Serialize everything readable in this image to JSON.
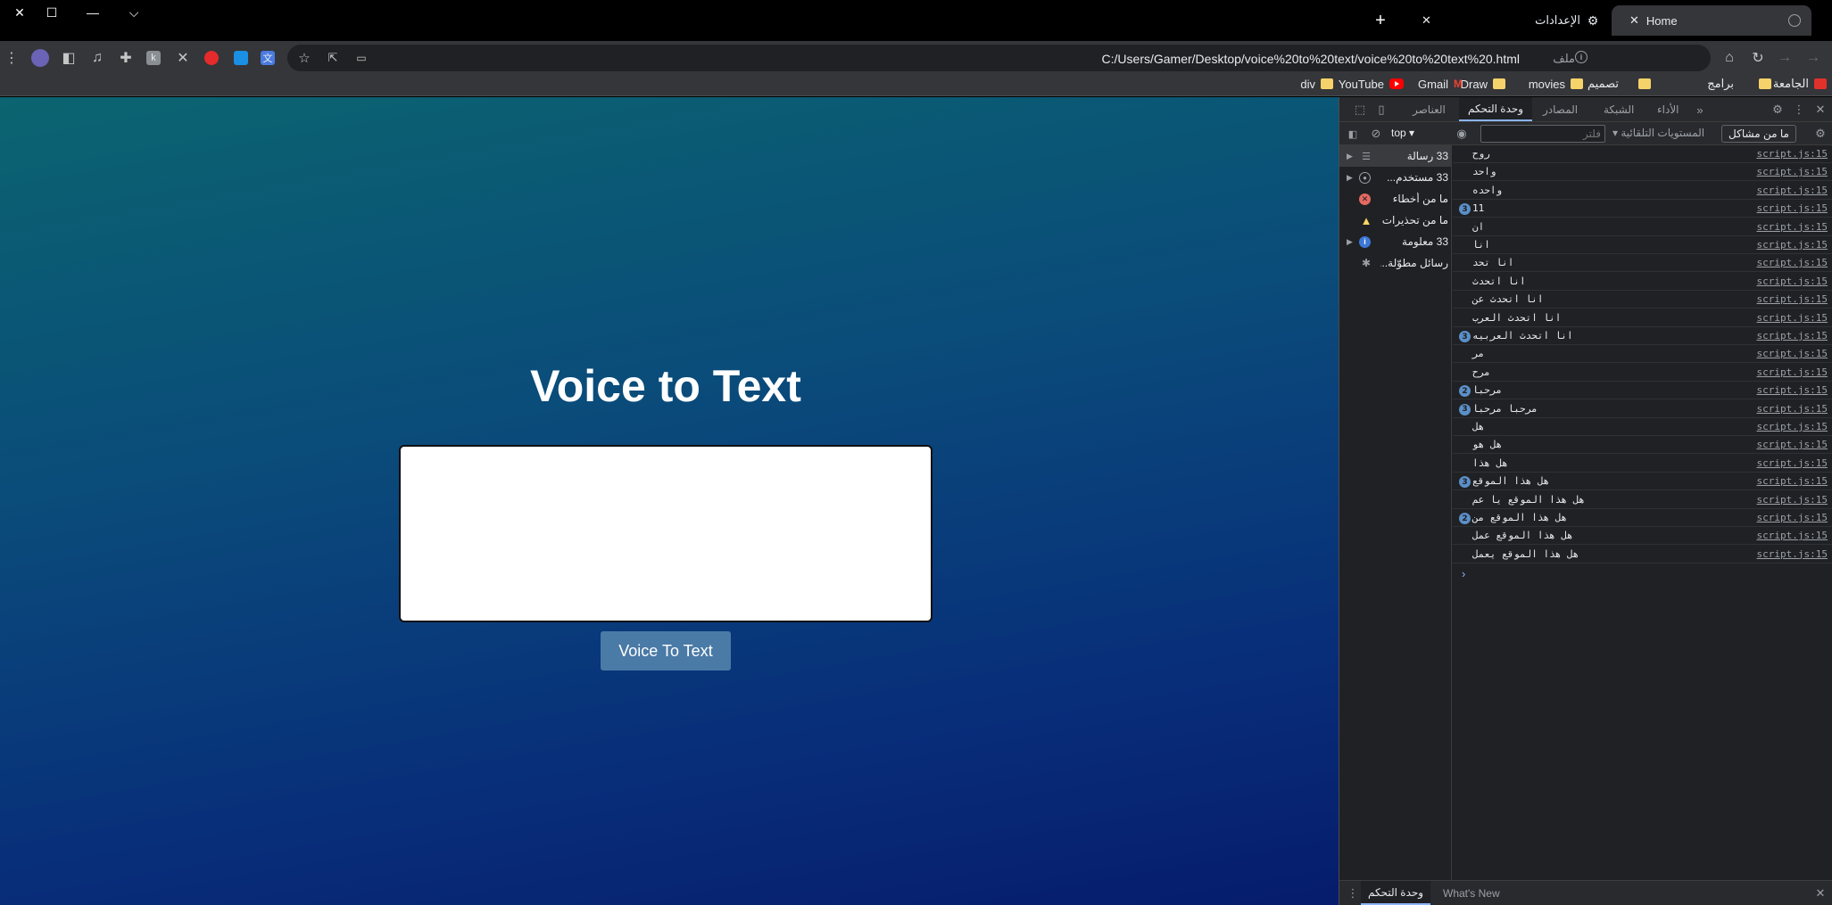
{
  "window": {
    "close_glyph": "✕",
    "maximize_glyph": "☐",
    "minimize_glyph": "—",
    "tab_search_glyph": "⌵"
  },
  "tabs": [
    {
      "title": "Home",
      "active": true
    },
    {
      "title": "الإعدادات",
      "active": false
    }
  ],
  "new_tab_glyph": "+",
  "close_tab_glyph": "✕",
  "address_bar": {
    "url": "C:/Users/Gamer/Desktop/voice%20to%20text/voice%20to%20text%20.html",
    "scheme_label": "ملف"
  },
  "bookmarks": [
    {
      "label": "الجامعة",
      "icon": "folder"
    },
    {
      "label": "برامج",
      "icon": "folder"
    },
    {
      "label": "تصميم",
      "icon": "folder"
    },
    {
      "label": "movies",
      "icon": "folder"
    },
    {
      "label": "Draw",
      "icon": "folder"
    },
    {
      "label": "Gmail",
      "icon": "gmail"
    },
    {
      "label": "YouTube",
      "icon": "youtube"
    },
    {
      "label": "div",
      "icon": "folder"
    }
  ],
  "page": {
    "title": "Voice to Text",
    "textarea_value": "",
    "button_label": "Voice To Text"
  },
  "devtools": {
    "tabs": [
      "العناصر",
      "وحدة التحكم",
      "المصادر",
      "الشبكة",
      "الأداء"
    ],
    "active_tab": "وحدة التحكم",
    "more_tabs_glyph": "»",
    "context": "top",
    "filter_placeholder": "فلتر",
    "levels_label": "المستويات التلقائية",
    "issues_label": "ما من مشاكل",
    "sidebar": [
      {
        "label": "33 رسالة",
        "icon": "list-icon",
        "expandable": true,
        "selected": true
      },
      {
        "label": "33 مستخدم...",
        "icon": "user-icon",
        "expandable": true,
        "selected": false
      },
      {
        "label": "ما من أخطاء",
        "icon": "error-icon",
        "expandable": false,
        "selected": false
      },
      {
        "label": "ما من تحذيرات",
        "icon": "warning-icon",
        "expandable": false,
        "selected": false
      },
      {
        "label": "33 معلومة",
        "icon": "info-icon",
        "expandable": true,
        "selected": false
      },
      {
        "label": "رسائل مطوّلة...",
        "icon": "bug-icon",
        "expandable": false,
        "selected": false
      }
    ],
    "console_messages": [
      {
        "text": "روح",
        "count": null,
        "source": "script.js:15"
      },
      {
        "text": "واحد",
        "count": null,
        "source": "script.js:15"
      },
      {
        "text": "واحده",
        "count": null,
        "source": "script.js:15"
      },
      {
        "text": "11",
        "count": "3",
        "source": "script.js:15"
      },
      {
        "text": "ان",
        "count": null,
        "source": "script.js:15"
      },
      {
        "text": "انا",
        "count": null,
        "source": "script.js:15"
      },
      {
        "text": "انا تحد",
        "count": null,
        "source": "script.js:15"
      },
      {
        "text": "انا اتحدث",
        "count": null,
        "source": "script.js:15"
      },
      {
        "text": "انا اتحدث عن",
        "count": null,
        "source": "script.js:15"
      },
      {
        "text": "انا اتحدث العرب",
        "count": null,
        "source": "script.js:15"
      },
      {
        "text": "انا اتحدث العربيه",
        "count": "3",
        "source": "script.js:15"
      },
      {
        "text": "مر",
        "count": null,
        "source": "script.js:15"
      },
      {
        "text": "مرح",
        "count": null,
        "source": "script.js:15"
      },
      {
        "text": "مرحبا",
        "count": "2",
        "source": "script.js:15"
      },
      {
        "text": "مرحبا مرحبا",
        "count": "3",
        "source": "script.js:15"
      },
      {
        "text": "هل",
        "count": null,
        "source": "script.js:15"
      },
      {
        "text": "هل هو",
        "count": null,
        "source": "script.js:15"
      },
      {
        "text": "هل هذا",
        "count": null,
        "source": "script.js:15"
      },
      {
        "text": "هل هذا الموقع",
        "count": "3",
        "source": "script.js:15"
      },
      {
        "text": "هل هذا الموقع يا عم",
        "count": null,
        "source": "script.js:15"
      },
      {
        "text": "هل هذا الموقع من",
        "count": "2",
        "source": "script.js:15"
      },
      {
        "text": "هل هذا الموقع عمل",
        "count": null,
        "source": "script.js:15"
      },
      {
        "text": "هل هذا الموقع يعمل",
        "count": null,
        "source": "script.js:15"
      }
    ],
    "prompt_glyph": "›",
    "drawer_tabs": [
      "وحدة التحكم",
      "What's New"
    ]
  },
  "colors": {
    "page_gradient_top": "#0b6470",
    "page_gradient_bottom": "#061c6c",
    "button_bg": "#4a7aa6",
    "devtools_bg": "#202124"
  }
}
